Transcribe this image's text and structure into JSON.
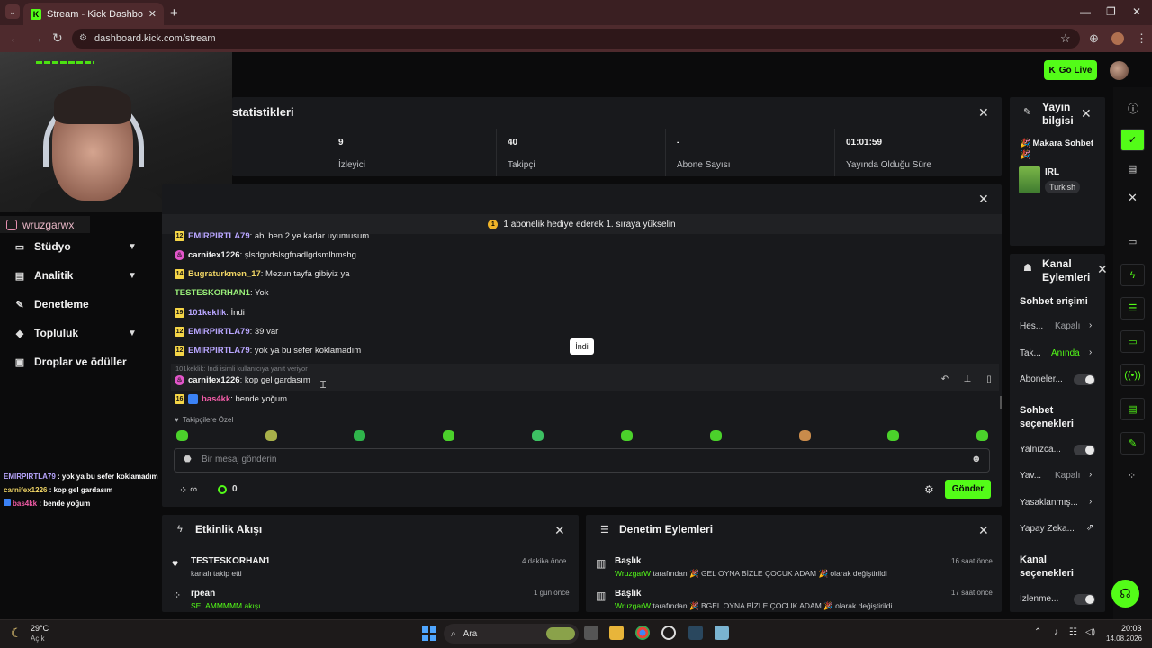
{
  "browser": {
    "tab_title": "Stream - Kick Dashboard",
    "url": "dashboard.kick.com/stream",
    "new_tab": "+",
    "tab_close": "✕"
  },
  "header": {
    "go_live": "Go Live"
  },
  "webcam": {
    "instagram": "wruzgarwx"
  },
  "sidebar": {
    "items": [
      {
        "label": "Stüdyo",
        "icon": "studio-icon"
      },
      {
        "label": "Analitik",
        "icon": "analytics-icon"
      },
      {
        "label": "Denetleme",
        "icon": "moderation-icon"
      },
      {
        "label": "Topluluk",
        "icon": "community-icon"
      },
      {
        "label": "Droplar ve ödüller",
        "icon": "drops-icon"
      }
    ]
  },
  "overlay_chat": [
    {
      "user": "EMIRPIRTLA79",
      "text": " : yok ya bu sefer koklamadım",
      "color": "#ffffff"
    },
    {
      "user": "carnifex1226",
      "text": " : kop gel gardasım",
      "color": "#ffffff"
    },
    {
      "user": "bas4kk",
      "text": " : bende yoğum",
      "color": "#f45ca8"
    }
  ],
  "stats": {
    "title": "statistikleri",
    "items": [
      {
        "value": "9",
        "label": "İzleyici"
      },
      {
        "value": "40",
        "label": "Takipçi"
      },
      {
        "value": "-",
        "label": "Abone Sayısı"
      },
      {
        "value": "01:01:59",
        "label": "Yayında Olduğu Süre"
      }
    ]
  },
  "chat": {
    "banner": "1 abonelik hediye ederek 1. sıraya yükselin",
    "messages": [
      {
        "badge": "12",
        "badge_color": "#f5d547",
        "user": "EMIRPIRTLA79",
        "user_color": "#b9a6ff",
        "text": ": abi ben 2 ye kadar uyumusum"
      },
      {
        "badge": "♨",
        "badge_color": "#e255c9",
        "user": "carnifex1226",
        "user_color": "#f0f0f0",
        "text": ": şlsdgndslsgfnadlgdsmlhmshg"
      },
      {
        "badge": "14",
        "badge_color": "#f5d547",
        "user": "Bugraturkmen_17",
        "user_color": "#f0d565",
        "text": ": Mezun tayfa gibiyiz ya"
      },
      {
        "badge": "",
        "badge_color": "",
        "user": "TESTESKORHAN1",
        "user_color": "#9af07a",
        "text": ": Yok"
      },
      {
        "badge": "19",
        "badge_color": "#f5d547",
        "user": "101keklik",
        "user_color": "#b9a6ff",
        "text": ": İndi"
      },
      {
        "badge": "12",
        "badge_color": "#f5d547",
        "user": "EMIRPIRTLA79",
        "user_color": "#b9a6ff",
        "text": ": 39 var"
      },
      {
        "badge": "12",
        "badge_color": "#f5d547",
        "user": "EMIRPIRTLA79",
        "user_color": "#b9a6ff",
        "text": ": yok ya bu sefer koklamadım"
      },
      {
        "badge": "♨",
        "badge_color": "#e255c9",
        "user": "carnifex1226",
        "user_color": "#f0f0f0",
        "text": ": kop gel gardasım"
      },
      {
        "badge": "16",
        "badge_color": "#f5d547",
        "user": "bas4kk",
        "user_color": "#f45ca8",
        "text": ": bende yoğum"
      }
    ],
    "reply_note": "101keklik: İndi isimli kullanıcıya yanıt veriyor",
    "tooltip": "İndi",
    "followers_only": "Takipçilere Özel",
    "input_placeholder": "Bir mesaj gönderin",
    "infinity": "∞",
    "points": "0",
    "send": "Gönder"
  },
  "activity": {
    "title": "Etkinlik Akışı",
    "items": [
      {
        "name": "TESTESKORHAN1",
        "desc": "kanalı takip etti",
        "time": "4 dakika önce"
      },
      {
        "name": "rpean",
        "desc": "SELAMMMMM akışı",
        "time": "1 gün önce"
      }
    ]
  },
  "moderation": {
    "title": "Denetim Eylemleri",
    "items": [
      {
        "title": "Başlık",
        "user": "WruzgarW",
        "text": " tarafından 🎉 GEL OYNA BİZLE ÇOCUK ADAM 🎉 olarak değiştirildi",
        "time": "16 saat önce"
      },
      {
        "title": "Başlık",
        "user": "WruzgarW",
        "text": " tarafından 🎉 BGEL OYNA BİZLE ÇOCUK ADAM 🎉 olarak değiştirildi",
        "time": "17 saat önce"
      }
    ]
  },
  "stream_info": {
    "title": "Yayın bilgisi",
    "stream_title": "🎉 Makara Sohbet 🎉",
    "category": "IRL",
    "language": "Turkish"
  },
  "channel_actions": {
    "title": "Kanal Eylemleri",
    "chat_access": "Sohbet erişimi",
    "rows": [
      {
        "label": "Hes...",
        "value": "Kapalı"
      },
      {
        "label": "Tak...",
        "value": "Anında"
      },
      {
        "label": "Aboneler...",
        "value": ""
      }
    ],
    "chat_options": "Sohbet seçenekleri",
    "option_rows": [
      {
        "label": "Yalnızca...",
        "value": ""
      },
      {
        "label": "Yav...",
        "value": "Kapalı"
      },
      {
        "label": "Yasaklanmış...",
        "value": ""
      },
      {
        "label": "Yapay Zeka...",
        "value": ""
      }
    ],
    "channel_options": "Kanal seçenekleri",
    "last_row": "İzlenme..."
  },
  "taskbar": {
    "weather_temp": "29°C",
    "weather_desc": "Açık",
    "search": "Ara",
    "time": "20:03",
    "date": "14.08.2026"
  },
  "colors": {
    "accent": "#53fc18",
    "panel": "#18191c",
    "background": "#0b0b0c"
  }
}
